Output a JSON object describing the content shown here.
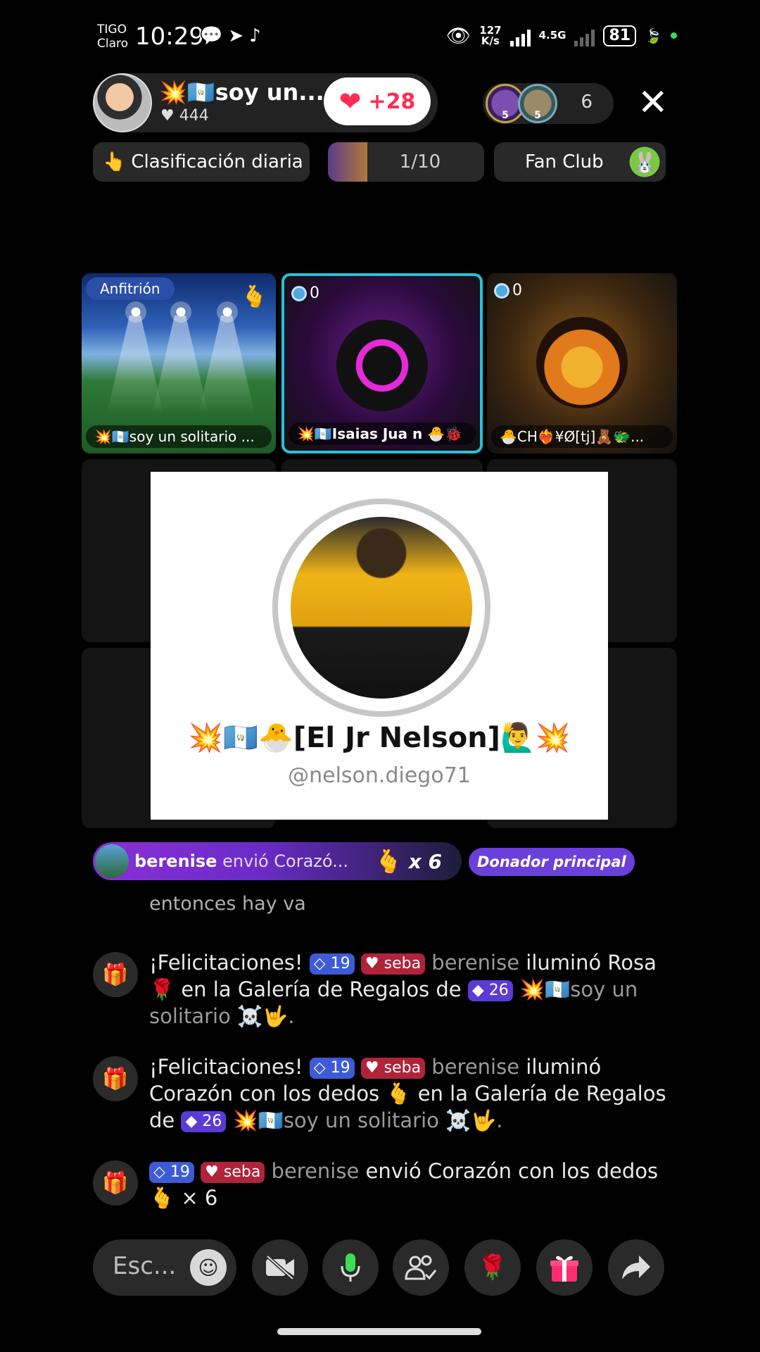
{
  "status_bar": {
    "carrier_top": "TIGO",
    "carrier_bottom": "Claro",
    "time": "10:29",
    "net_speed_value": "127",
    "net_speed_unit": "K/s",
    "network_type": "4.5G",
    "battery": "81"
  },
  "host": {
    "name": "💥🇬🇹soy un...",
    "likes": "444",
    "follow_count": "+28"
  },
  "viewers": {
    "badge_levels": [
      "5",
      "5"
    ],
    "count": "6"
  },
  "chips": {
    "ranking": "Clasificación diaria",
    "goal": "1/10",
    "fan_club": "Fan Club"
  },
  "guests": {
    "host_tile": {
      "badge": "Anfitrión",
      "name": "💥🇬🇹soy un solitario ..."
    },
    "guest1": {
      "gems": "0",
      "name": "💥🇬🇹Isaias Jua n 🐣🐞"
    },
    "guest2": {
      "gems": "0",
      "name": "🐣CH❤️‍🔥¥Ø[tj]🧸🐲..."
    }
  },
  "profile_card": {
    "name": "💥🇬🇹🐣[El Jr Nelson]🙋‍♂️💥",
    "handle": "@nelson.diego71"
  },
  "gift_banner": {
    "user": "berenise",
    "action": "envió Corazó...",
    "multiplier": "x 6",
    "donor_label": "Donador principal"
  },
  "chat": {
    "previous_line": "entonces hay va",
    "messages": [
      {
        "congrats": "¡Felicitaciones!",
        "level": "19",
        "fan": "seba",
        "user": "berenise",
        "body_a": "iluminó Rosa 🌹 en la Galería de Regalos de",
        "level2": "26",
        "target": "💥🇬🇹soy un solitario ☠️🤟."
      },
      {
        "congrats": "¡Felicitaciones!",
        "level": "19",
        "fan": "seba",
        "user": "berenise",
        "body_a": "iluminó Corazón con los dedos 🫰 en la Galería de Regalos de",
        "level2": "26",
        "target": "💥🇬🇹soy un solitario ☠️🤟."
      },
      {
        "level": "19",
        "fan": "seba",
        "user": "berenise",
        "body_a": "envió Corazón con los dedos 🫰 × 6"
      }
    ]
  },
  "bottom_bar": {
    "input_placeholder": "Esc..."
  }
}
